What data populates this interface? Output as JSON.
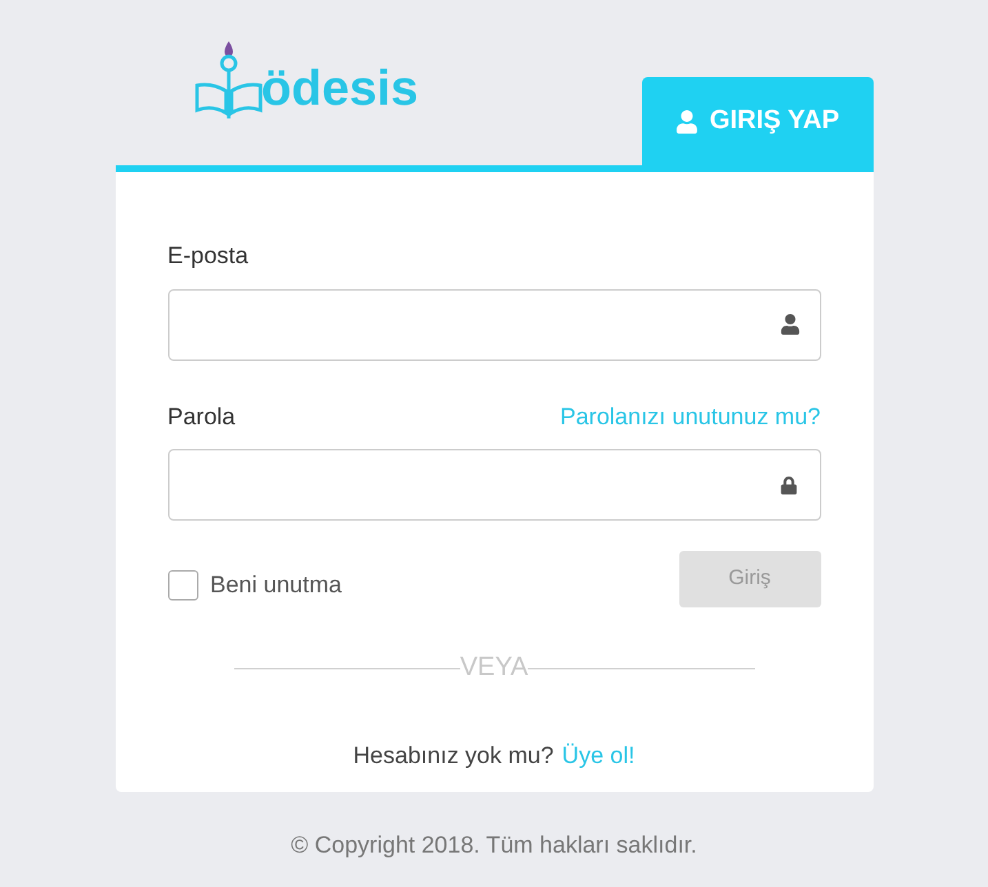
{
  "logo": {
    "text": "ödesis"
  },
  "tab": {
    "label": "GIRIŞ YAP",
    "selected": true
  },
  "form": {
    "email": {
      "label": "E-posta"
    },
    "password": {
      "label": "Parola",
      "forgot_link": "Parolanızı unutunuz mu?"
    },
    "remember": {
      "label": "Beni unutma",
      "checked": false
    },
    "submit": {
      "label": "Giriş",
      "disabled": true
    },
    "divider": "VEYA",
    "signup": {
      "text": "Hesabınız yok mu?",
      "link": "Üye ol!"
    }
  },
  "footer": "© Copyright 2018. Tüm hakları saklıdır."
}
